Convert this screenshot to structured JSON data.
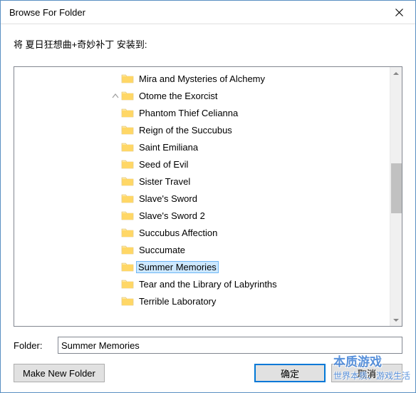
{
  "titlebar": {
    "text": "Browse For Folder"
  },
  "prompt": "将 夏日狂想曲+奇妙补丁 安装到:",
  "folders": [
    {
      "label": "Mira and Mysteries of Alchemy",
      "expandable": false,
      "selected": false
    },
    {
      "label": "Otome the Exorcist",
      "expandable": true,
      "selected": false
    },
    {
      "label": "Phantom Thief Celianna",
      "expandable": false,
      "selected": false
    },
    {
      "label": "Reign of the Succubus",
      "expandable": false,
      "selected": false
    },
    {
      "label": "Saint Emiliana",
      "expandable": false,
      "selected": false
    },
    {
      "label": "Seed of Evil",
      "expandable": false,
      "selected": false
    },
    {
      "label": "Sister Travel",
      "expandable": false,
      "selected": false
    },
    {
      "label": "Slave's Sword",
      "expandable": false,
      "selected": false
    },
    {
      "label": "Slave's Sword 2",
      "expandable": false,
      "selected": false
    },
    {
      "label": "Succubus Affection",
      "expandable": false,
      "selected": false
    },
    {
      "label": "Succumate",
      "expandable": false,
      "selected": false
    },
    {
      "label": "Summer Memories",
      "expandable": false,
      "selected": true
    },
    {
      "label": "Tear and the Library of Labyrinths",
      "expandable": false,
      "selected": false
    },
    {
      "label": "Terrible Laboratory",
      "expandable": false,
      "selected": false
    }
  ],
  "folder_field": {
    "label": "Folder:",
    "value": "Summer Memories"
  },
  "buttons": {
    "mkdir": "Make New Folder",
    "ok": "确定",
    "cancel": "取消"
  },
  "watermark": {
    "main": "本质游戏",
    "sub": "世界本质、游戏生活"
  }
}
